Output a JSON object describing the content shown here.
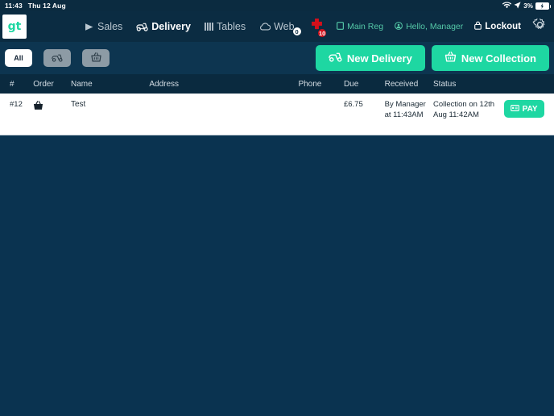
{
  "statusbar": {
    "time": "11:43",
    "date": "Thu 12 Aug",
    "battery_pct": "3%",
    "wifi_icon": "wifi-icon",
    "location_icon": "location-arrow-icon",
    "battery_icon": "battery-charging-icon"
  },
  "header": {
    "logo_text": "gt",
    "nav": [
      {
        "label": "Sales",
        "icon": "play-triangle-icon",
        "active": false,
        "badge": null
      },
      {
        "label": "Delivery",
        "icon": "moped-icon",
        "active": true,
        "badge": null
      },
      {
        "label": "Tables",
        "icon": "tables-grid-icon",
        "active": false,
        "badge": null
      },
      {
        "label": "Web",
        "icon": "cloud-icon",
        "active": false,
        "badge": "0"
      }
    ],
    "alerts_badge": "10",
    "alerts_icon": "alert-cross-icon",
    "register": {
      "label": "Main Reg",
      "icon": "register-icon"
    },
    "user": {
      "label": "Hello, Manager",
      "icon": "user-circle-icon"
    },
    "lockout": {
      "label": "Lockout",
      "icon": "lock-icon"
    },
    "settings_icon": "gear-icon"
  },
  "toolbar": {
    "filters": [
      {
        "label": "All",
        "icon": null,
        "active": true
      },
      {
        "label": "",
        "icon": "moped-icon",
        "active": false
      },
      {
        "label": "",
        "icon": "basket-icon",
        "active": false
      }
    ],
    "new_delivery": {
      "label": "New Delivery",
      "icon": "moped-icon"
    },
    "new_collection": {
      "label": "New Collection",
      "icon": "basket-icon"
    }
  },
  "table": {
    "columns": [
      "#",
      "Order",
      "Name",
      "Address",
      "Phone",
      "Due",
      "Received",
      "Status"
    ],
    "rows": [
      {
        "number": "#12",
        "order_icon": "basket-icon",
        "name": "Test",
        "address": "",
        "phone": "",
        "due": "£6.75",
        "received": "By Manager at 11:43AM",
        "status": "Collection on 12th Aug 11:42AM",
        "pay_label": "PAY",
        "pay_icon": "card-icon"
      }
    ]
  },
  "colors": {
    "accent": "#1ed7a2",
    "header_bg": "#0b2c42",
    "toolbar_bg": "#0d3550",
    "thead_bg": "#0a2a3f",
    "content_bg": "#0a3350",
    "alert_red": "#d4101b",
    "muted_text": "#55c9a8"
  }
}
